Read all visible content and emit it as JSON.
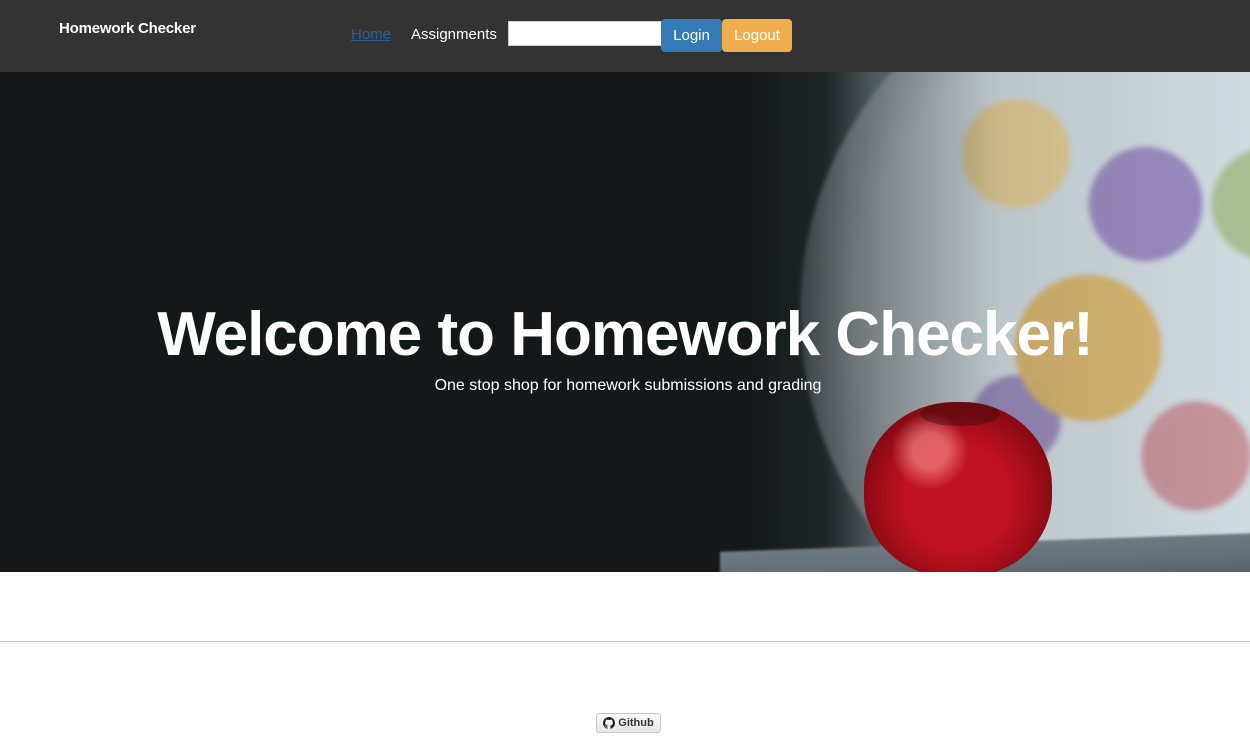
{
  "navbar": {
    "brand": "Homework Checker",
    "links": [
      {
        "label": "Home",
        "active": true
      },
      {
        "label": "Assignments",
        "active": false
      }
    ],
    "search": {
      "value": "",
      "placeholder": ""
    },
    "login_label": "Login",
    "logout_label": "Logout"
  },
  "hero": {
    "title": "Welcome to Homework Checker!",
    "subtitle": "One stop shop for homework submissions and grading"
  },
  "footer": {
    "github_label": "Github",
    "github_icon": "github-icon"
  },
  "colors": {
    "navbar_bg": "#333333",
    "login_btn": "#337ab7",
    "logout_btn": "#f0ad4e",
    "active_link": "#2d5f93"
  }
}
